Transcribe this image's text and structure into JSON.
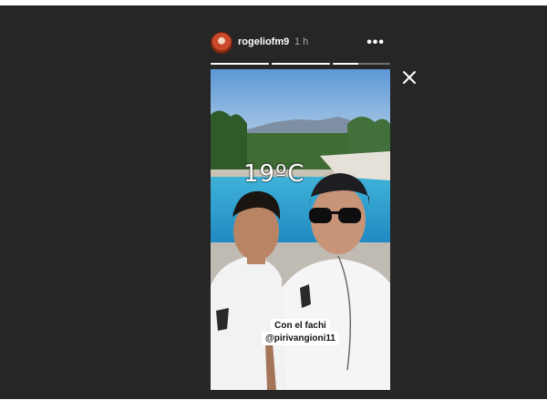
{
  "header": {
    "username": "rogeliofm9",
    "time": "1 h",
    "more_label": "•••"
  },
  "progress": [
    {
      "fraction": 1.0
    },
    {
      "fraction": 1.0
    },
    {
      "fraction": 0.45
    }
  ],
  "story": {
    "temperature_sticker": "19ºC",
    "caption_line1": "Con el fachi",
    "caption_line2": "@pirivangioni11"
  },
  "colors": {
    "background": "#262626",
    "text": "#ffffff",
    "muted": "#a8a8a8"
  },
  "icons": [
    "avatar",
    "more-options-icon",
    "close-icon"
  ]
}
